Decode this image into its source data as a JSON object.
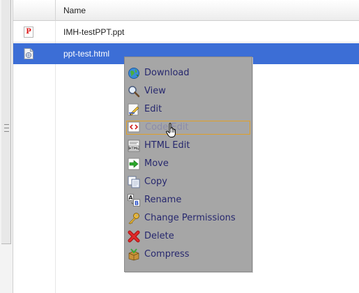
{
  "table": {
    "column_name_header": "Name",
    "rows": [
      {
        "name": "IMH-testPPT.ppt",
        "icon": "ppt-file-icon",
        "selected": false
      },
      {
        "name": "ppt-test.html",
        "icon": "html-file-icon",
        "selected": true
      }
    ]
  },
  "context_menu": {
    "items": [
      {
        "label": "Download",
        "icon": "globe-download-icon"
      },
      {
        "label": "View",
        "icon": "magnifier-icon"
      },
      {
        "label": "Edit",
        "icon": "pencil-icon"
      },
      {
        "label": "Code Edit",
        "icon": "code-icon",
        "hovered": true
      },
      {
        "label": "HTML Edit",
        "icon": "html-doc-icon"
      },
      {
        "label": "Move",
        "icon": "arrow-right-icon"
      },
      {
        "label": "Copy",
        "icon": "copy-icon"
      },
      {
        "label": "Rename",
        "icon": "rename-ab-icon"
      },
      {
        "label": "Change Permissions",
        "icon": "key-icon"
      },
      {
        "label": "Delete",
        "icon": "red-x-icon"
      },
      {
        "label": "Compress",
        "icon": "box-icon"
      }
    ]
  },
  "colors": {
    "selection": "#3c6ed6",
    "menu_background": "#a6a6a6",
    "menu_text": "#27286e",
    "hover_border": "#e0a028"
  }
}
